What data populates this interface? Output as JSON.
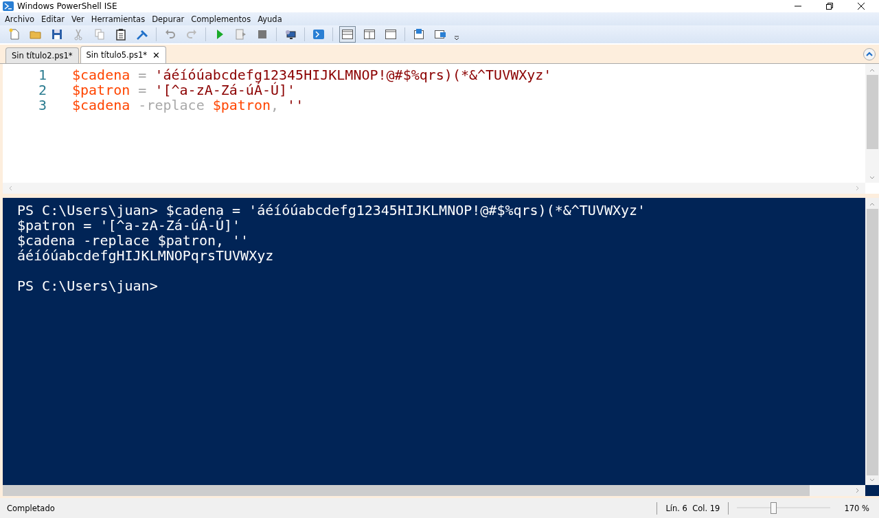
{
  "window": {
    "title": "Windows PowerShell ISE"
  },
  "menu": [
    "Archivo",
    "Editar",
    "Ver",
    "Herramientas",
    "Depurar",
    "Complementos",
    "Ayuda"
  ],
  "tabs": [
    {
      "label": "Sin título2.ps1*",
      "selected": false
    },
    {
      "label": "Sin título5.ps1*",
      "selected": true,
      "close": "✕"
    }
  ],
  "editor": {
    "lines": [
      {
        "number": "1",
        "tokens": [
          {
            "kind": "variable",
            "text": "$cadena"
          },
          {
            "kind": "operator",
            "text": " = "
          },
          {
            "kind": "string",
            "text": "'áéíóúabcdefg12345HIJKLMNOP!@#$%qrs)(*&^TUVWXyz'"
          }
        ]
      },
      {
        "number": "2",
        "tokens": [
          {
            "kind": "variable",
            "text": "$patron"
          },
          {
            "kind": "operator",
            "text": " = "
          },
          {
            "kind": "string",
            "text": "'[^a-zA-Zá-úÁ-Ú]'"
          }
        ]
      },
      {
        "number": "3",
        "tokens": [
          {
            "kind": "variable",
            "text": "$cadena"
          },
          {
            "kind": "operator",
            "text": " -replace "
          },
          {
            "kind": "variable",
            "text": "$patron"
          },
          {
            "kind": "operator",
            "text": ", "
          },
          {
            "kind": "string",
            "text": "''"
          }
        ]
      }
    ]
  },
  "console": {
    "lines": [
      "PS C:\\Users\\juan> $cadena = 'áéíóúabcdefg12345HIJKLMNOP!@#$%qrs)(*&^TUVWXyz'",
      "$patron = '[^a-zA-Zá-úÁ-Ú]'",
      "$cadena -replace $patron, ''",
      "áéíóúabcdefgHIJKLMNOPqrsTUVWXyz"
    ],
    "prompt": "PS C:\\Users\\juan>"
  },
  "status_bar": {
    "status": "Completado",
    "position": "Lín. 6  Col. 19",
    "zoom": {
      "level": 0.39,
      "reading": "170 %"
    }
  }
}
